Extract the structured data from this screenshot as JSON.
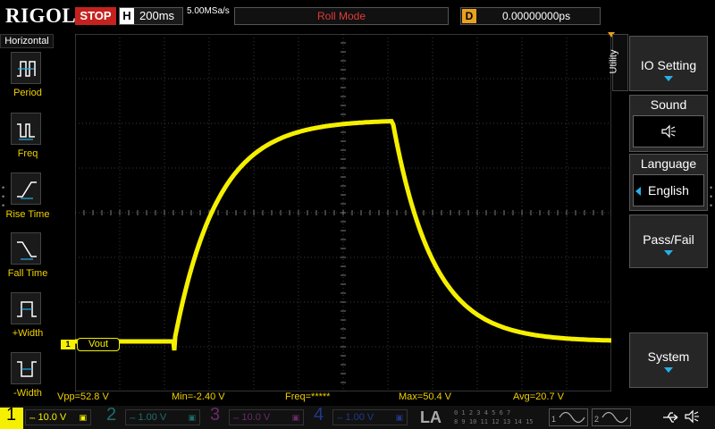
{
  "topbar": {
    "logo": "RIGOL",
    "run_state": "STOP",
    "timebase_tag": "H",
    "timebase": "200ms",
    "sample_rate": "5.00MSa/s",
    "mode": "Roll Mode",
    "delay_tag": "D",
    "delay": "0.00000000ps"
  },
  "left_menu": {
    "title": "Horizontal",
    "items": [
      {
        "label": "Period",
        "icon": "period-icon"
      },
      {
        "label": "Freq",
        "icon": "freq-icon"
      },
      {
        "label": "Rise Time",
        "icon": "rise-time-icon"
      },
      {
        "label": "Fall Time",
        "icon": "fall-time-icon"
      },
      {
        "label": "+Width",
        "icon": "positive-width-icon"
      },
      {
        "label": "-Width",
        "icon": "negative-width-icon"
      }
    ]
  },
  "trace": {
    "channel_marker": "1",
    "label": "Vout",
    "color": "#f5f000"
  },
  "measurements": {
    "vpp": "Vpp=52.8 V",
    "min": "Min=-2.40 V",
    "freq": "Freq=*****",
    "max": "Max=50.4 V",
    "avg": "Avg=20.7 V"
  },
  "right_menu": {
    "tab": "Utility",
    "io_setting": "IO Setting",
    "sound": "Sound",
    "sound_icon": "speaker-icon",
    "language": "Language",
    "language_value": "English",
    "pass_fail": "Pass/Fail",
    "system": "System"
  },
  "channels": [
    {
      "num": "1",
      "scale": "10.0 V",
      "color": "#f5f000"
    },
    {
      "num": "2",
      "scale": "1.00 V",
      "color": "#1e6e6e"
    },
    {
      "num": "3",
      "scale": "10.0 V",
      "color": "#6a2a6a"
    },
    {
      "num": "4",
      "scale": "1.00 V",
      "color": "#1e3a8a"
    }
  ],
  "logic": {
    "label": "LA",
    "row1": "0 1 2 3  4 5 6 7",
    "row2": "8 9 10 11 12 13 14 15",
    "digital_channels": [
      "D0",
      "D1",
      "D2",
      "D3",
      "D4",
      "D5",
      "D6",
      "D7",
      "D8",
      "D9",
      "D10",
      "D11",
      "D12",
      "D13",
      "D14",
      "D15"
    ]
  },
  "bottom_right": {
    "gen1": "1",
    "gen2": "2",
    "usb_icon": "usb-icon",
    "speaker_icon": "speaker-icon"
  },
  "colors": {
    "ch1": "#f5f000",
    "stop": "#c4221f",
    "mode_text": "#e03a3a",
    "delay_tag": "#e8a020",
    "accent": "#27b0e8"
  }
}
